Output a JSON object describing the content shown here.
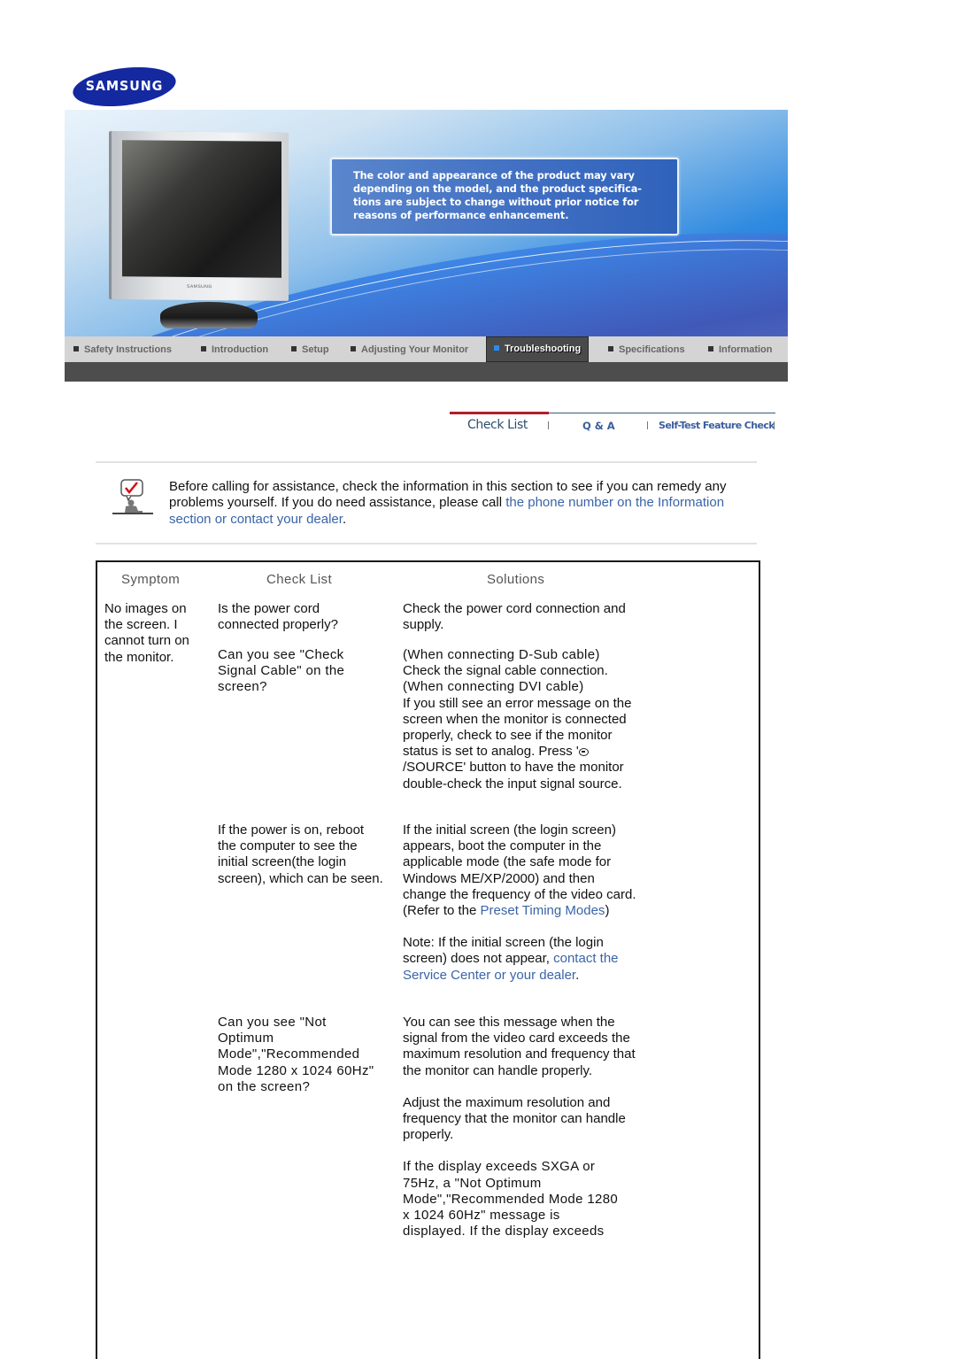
{
  "logo": {
    "text": "SAMSUNG",
    "color": "#1428a0"
  },
  "banner": {
    "notice": "The color and appearance of the product may vary depending on the model, and the product specifica-tions are subject to change without prior notice for reasons of performance enhancement.",
    "monitor_brand": "SAMSUNG"
  },
  "nav": {
    "items": [
      {
        "label": "Safety Instructions",
        "active": false
      },
      {
        "label": "Introduction",
        "active": false
      },
      {
        "label": "Setup",
        "active": false
      },
      {
        "label": "Adjusting Your Monitor",
        "active": false
      },
      {
        "label": "Troubleshooting",
        "active": true
      },
      {
        "label": "Specifications",
        "active": false
      },
      {
        "label": "Information",
        "active": false
      }
    ]
  },
  "subtabs": {
    "items": [
      {
        "label": "Check List",
        "active": true
      },
      {
        "label": "Q & A",
        "active": false
      },
      {
        "label": "Self-Test Feature Check",
        "active": false
      }
    ]
  },
  "intro": {
    "text": "Before calling for assistance, check the information in this section to see if you can remedy any problems yourself. If you do need assistance, please call ",
    "link": "the phone number on the Information section or contact your dealer",
    "end": "."
  },
  "table": {
    "headers": {
      "symptom": "Symptom",
      "checklist": "Check List",
      "solutions": "Solutions"
    },
    "symptom": "No images on the screen. I cannot turn on the monitor.",
    "rows": [
      {
        "check": "Is the power cord connected properly?",
        "solution": "Check the power cord connection and supply."
      },
      {
        "check": "Can you see \"Check Signal Cable\" on the screen?",
        "solution_dsub_heading": "(When connecting D-Sub cable)",
        "solution_dsub": "Check the signal cable connection.",
        "solution_dvi_heading": "(When connecting DVI cable)",
        "solution_dvi_a": "If you still see an error message on the screen when the monitor is connected properly, check to see if the monitor status is set to analog. Press '",
        "source_icon": "source-button-icon",
        "solution_dvi_b": "/SOURCE' button to have the monitor double-check the input signal source."
      },
      {
        "check": "If the power is on, reboot the computer to see the initial screen(the login screen), which can be seen.",
        "solution_a": "If the initial screen (the login screen) appears, boot the computer in the applicable mode (the safe mode for Windows ME/XP/2000) and then change the frequency of the video card.",
        "refer_prefix": "(Refer to the ",
        "refer_link": "Preset Timing Modes",
        "refer_suffix": ")",
        "note_prefix": "Note: If the initial screen (the login screen) does not appear, ",
        "note_link": "contact the Service Center or your dealer",
        "note_suffix": "."
      },
      {
        "check": "Can you see \"Not Optimum Mode\",\"Recommended Mode 1280 x 1024 60Hz\" on the screen?",
        "solution_a": "You can see this message when the signal from the video card exceeds the maximum resolution and frequency that the monitor can handle properly.",
        "solution_b": "Adjust the maximum resolution and frequency that the monitor can handle properly.",
        "solution_c": "If the display exceeds SXGA or 75Hz, a \"Not Optimum Mode\",\"Recommended Mode 1280 x 1024 60Hz\" message is displayed. If the display exceeds"
      }
    ]
  },
  "colors": {
    "link": "#3a64a8",
    "active_tab_marker": "#b01e2a",
    "nav_active_bg": "#4a4a4a"
  }
}
